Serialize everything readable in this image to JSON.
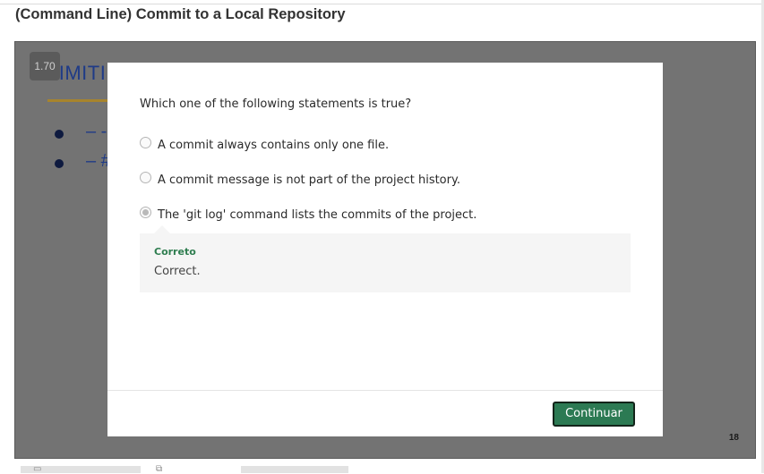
{
  "page": {
    "title": "(Command Line) Commit to a Local Repository"
  },
  "player": {
    "speed": "1.70",
    "slide_number": "18",
    "slide": {
      "title_fragment": "LIMITI",
      "bullets": [
        "– -",
        "– #"
      ]
    }
  },
  "quiz": {
    "question": "Which one of the following statements is true?",
    "options": [
      {
        "label": "A commit always contains only one file.",
        "selected": false
      },
      {
        "label": "A commit message is not part of the project history.",
        "selected": false
      },
      {
        "label": "The 'git log' command lists the commits of the project.",
        "selected": true
      }
    ],
    "feedback": {
      "title": "Correto",
      "text": "Correct."
    },
    "continue_label": "Continuar"
  },
  "colors": {
    "accent_green": "#2c7a53",
    "feedback_green": "#2e7d4f",
    "slide_blue": "#1f3b87"
  },
  "icons": {
    "left_control": "transcript-icon",
    "middle_control": "external-link-icon"
  }
}
